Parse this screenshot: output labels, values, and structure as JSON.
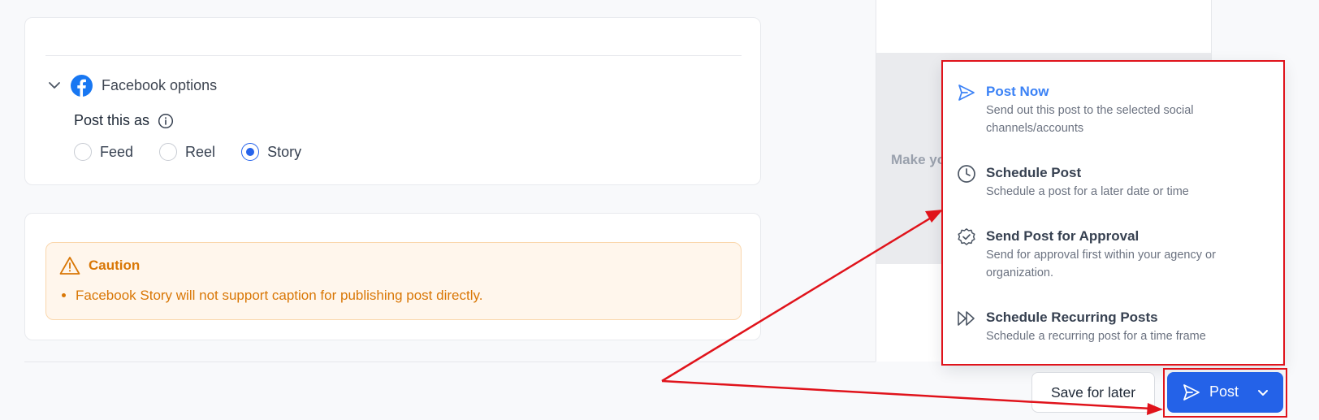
{
  "facebook_options": {
    "label": "Facebook options",
    "post_as_label": "Post this as",
    "radio_options": [
      {
        "label": "Feed",
        "checked": false
      },
      {
        "label": "Reel",
        "checked": false
      },
      {
        "label": "Story",
        "checked": true
      }
    ]
  },
  "caution": {
    "title": "Caution",
    "items": [
      "Facebook Story will not support caption for publishing post directly."
    ]
  },
  "preview": {
    "partial_text": "Make yo"
  },
  "post_menu": {
    "items": [
      {
        "icon": "send-icon",
        "title": "Post Now",
        "description": "Send out this post to the selected social channels/accounts",
        "active": true
      },
      {
        "icon": "clock-icon",
        "title": "Schedule Post",
        "description": "Schedule a post for a later date or time",
        "active": false
      },
      {
        "icon": "badge-check-icon",
        "title": "Send Post for Approval",
        "description": "Send for approval first within your agency or organization.",
        "active": false
      },
      {
        "icon": "fast-forward-icon",
        "title": "Schedule Recurring Posts",
        "description": "Schedule a recurring post for a time frame",
        "active": false
      }
    ]
  },
  "footer": {
    "save_label": "Save for later",
    "post_label": "Post"
  },
  "colors": {
    "primary": "#2462e8",
    "active_link": "#3b82f6",
    "warning": "#d97706",
    "warning_bg": "#fff6ec",
    "annotation": "#e0131b",
    "facebook": "#1877f2"
  }
}
